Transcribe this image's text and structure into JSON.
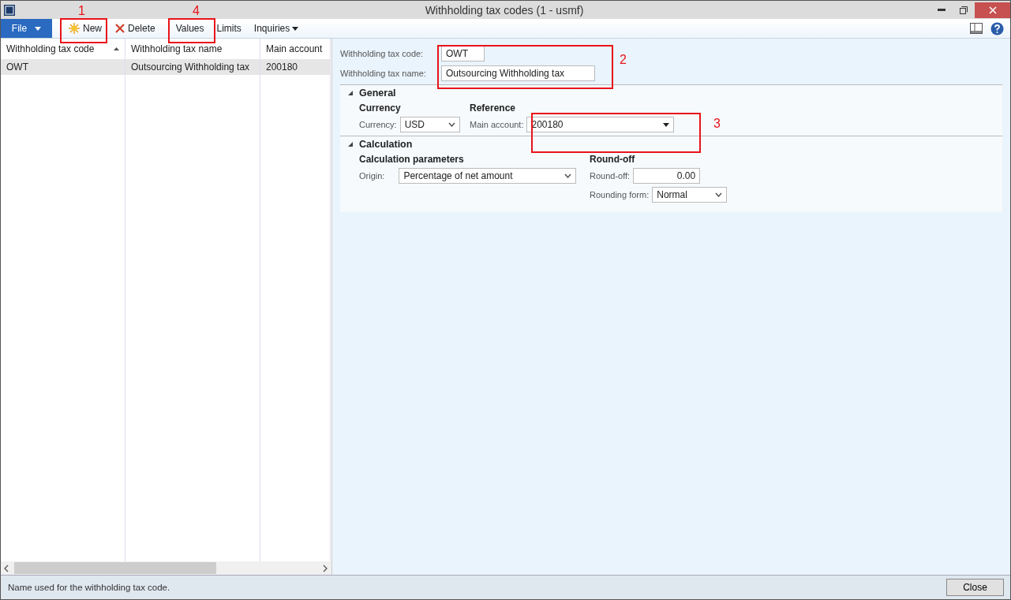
{
  "window": {
    "title": "Withholding tax codes (1 - usmf)"
  },
  "ribbon": {
    "file_tab": "File",
    "buttons": [
      {
        "label": "New",
        "kind": "sun"
      },
      {
        "label": "Delete",
        "kind": "cross"
      },
      {
        "label": "Values",
        "kind": "plain"
      },
      {
        "label": "Limits",
        "kind": "plain"
      },
      {
        "label": "Inquiries",
        "kind": "menu"
      }
    ]
  },
  "grid": {
    "columns": [
      {
        "label": "Withholding tax code",
        "sorted": true
      },
      {
        "label": "Withholding tax name",
        "sorted": false
      },
      {
        "label": "Main account",
        "sorted": false
      }
    ],
    "rows": [
      {
        "selected": true,
        "cells": [
          "OWT",
          "Outsourcing Withholding tax",
          "200180"
        ]
      }
    ]
  },
  "header_fields": [
    {
      "label": "Withholding tax code:",
      "value": "OWT",
      "kind": "short"
    },
    {
      "label": "Withholding tax name:",
      "value": "Outsourcing Withholding tax",
      "kind": "long"
    }
  ],
  "sections": [
    {
      "title": "General",
      "expanded": true,
      "groups": [
        {
          "title": "Currency",
          "fields": [
            {
              "label": "Currency:",
              "value": "USD",
              "kind": "combo"
            }
          ]
        },
        {
          "title": "Reference",
          "fields": [
            {
              "label": "Main account:",
              "value": "200180",
              "kind": "lookup"
            }
          ]
        }
      ]
    },
    {
      "title": "Calculation",
      "expanded": true,
      "groups": [
        {
          "title": "Calculation parameters",
          "fields": [
            {
              "label": "Origin:",
              "value": "Percentage of net amount",
              "kind": "wide-combo"
            }
          ]
        },
        {
          "title": "Round-off",
          "fields": [
            {
              "label": "Round-off:",
              "value": "0.00",
              "kind": "number"
            },
            {
              "label": "Rounding form:",
              "value": "Normal",
              "kind": "combo"
            }
          ]
        }
      ]
    }
  ],
  "status_bar": {
    "text": "Name used for the withholding tax code.",
    "close": "Close"
  },
  "annotations": [
    {
      "label": "1"
    },
    {
      "label": "4"
    },
    {
      "label": "2"
    },
    {
      "label": "3"
    }
  ]
}
